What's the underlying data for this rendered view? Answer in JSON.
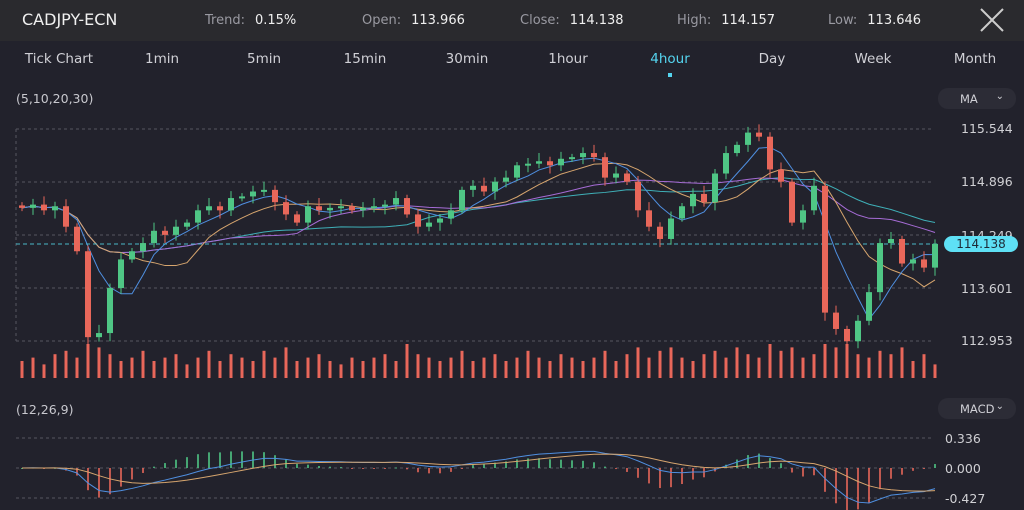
{
  "header": {
    "symbol": "CADJPY-ECN",
    "stats": [
      {
        "label": "Trend:",
        "value": "0.15%"
      },
      {
        "label": "Open:",
        "value": "113.966"
      },
      {
        "label": "Close:",
        "value": "114.138"
      },
      {
        "label": "High:",
        "value": "114.157"
      },
      {
        "label": "Low:",
        "value": "113.646"
      }
    ],
    "close_icon": "close-x-icon"
  },
  "timeframes": [
    "Tick Chart",
    "1min",
    "5min",
    "15min",
    "30min",
    "1hour",
    "4hour",
    "Day",
    "Week",
    "Month"
  ],
  "active_timeframe": "4hour",
  "accent": "#55d4ef",
  "main": {
    "params": "(5,10,20,30)",
    "indicator": "MA",
    "axis": [
      "115.544",
      "114.896",
      "114.249",
      "113.601",
      "112.953"
    ],
    "current_price": "114.138"
  },
  "sub": {
    "params": "(12,26,9)",
    "indicator": "MACD",
    "axis": [
      "0.336",
      "0.000",
      "-0.427"
    ]
  },
  "colors": {
    "up": "#4fc685",
    "down": "#e8675a",
    "ma5": "#4f8fe0",
    "ma10": "#d6a56e",
    "ma20": "#a66cd6",
    "ma30": "#3fb0b8"
  },
  "chart_data": {
    "type": "candlestick",
    "ylim": [
      112.953,
      115.544
    ],
    "closes": [
      114.58,
      114.62,
      114.55,
      114.6,
      114.35,
      114.05,
      113.0,
      113.05,
      113.6,
      113.95,
      114.05,
      114.15,
      114.3,
      114.25,
      114.35,
      114.4,
      114.55,
      114.6,
      114.55,
      114.7,
      114.72,
      114.78,
      114.8,
      114.65,
      114.5,
      114.4,
      114.6,
      114.55,
      114.58,
      114.6,
      114.55,
      114.58,
      114.6,
      114.62,
      114.7,
      114.5,
      114.35,
      114.4,
      114.45,
      114.55,
      114.8,
      114.85,
      114.78,
      114.9,
      114.95,
      115.1,
      115.12,
      115.15,
      115.1,
      115.18,
      115.2,
      115.25,
      115.2,
      114.95,
      115.0,
      114.9,
      114.55,
      114.35,
      114.2,
      114.45,
      114.6,
      114.75,
      114.65,
      115.0,
      115.25,
      115.35,
      115.5,
      115.45,
      115.05,
      114.9,
      114.4,
      114.55,
      114.85,
      113.3,
      113.1,
      112.95,
      113.2,
      113.55,
      114.15,
      114.2,
      113.9,
      113.95,
      113.85,
      114.14
    ],
    "volume": [
      0.5,
      0.6,
      0.4,
      0.7,
      0.8,
      0.6,
      1.0,
      0.9,
      0.7,
      0.5,
      0.6,
      0.8,
      0.5,
      0.6,
      0.7,
      0.4,
      0.6,
      0.8,
      0.5,
      0.7,
      0.6,
      0.5,
      0.8,
      0.6,
      0.9,
      0.5,
      0.6,
      0.7,
      0.5,
      0.4,
      0.6,
      0.5,
      0.6,
      0.7,
      0.5,
      1.0,
      0.7,
      0.6,
      0.5,
      0.6,
      0.8,
      0.5,
      0.6,
      0.7,
      0.5,
      0.6,
      0.8,
      0.6,
      0.5,
      0.7,
      0.6,
      0.5,
      0.6,
      0.8,
      0.5,
      0.7,
      0.9,
      0.6,
      0.8,
      0.9,
      0.6,
      0.5,
      0.7,
      0.8,
      0.6,
      0.9,
      0.7,
      0.6,
      1.0,
      0.8,
      0.9,
      0.6,
      0.7,
      1.0,
      0.9,
      1.0,
      0.7,
      0.6,
      0.8,
      0.7,
      0.9,
      0.5,
      0.7,
      0.4
    ]
  }
}
